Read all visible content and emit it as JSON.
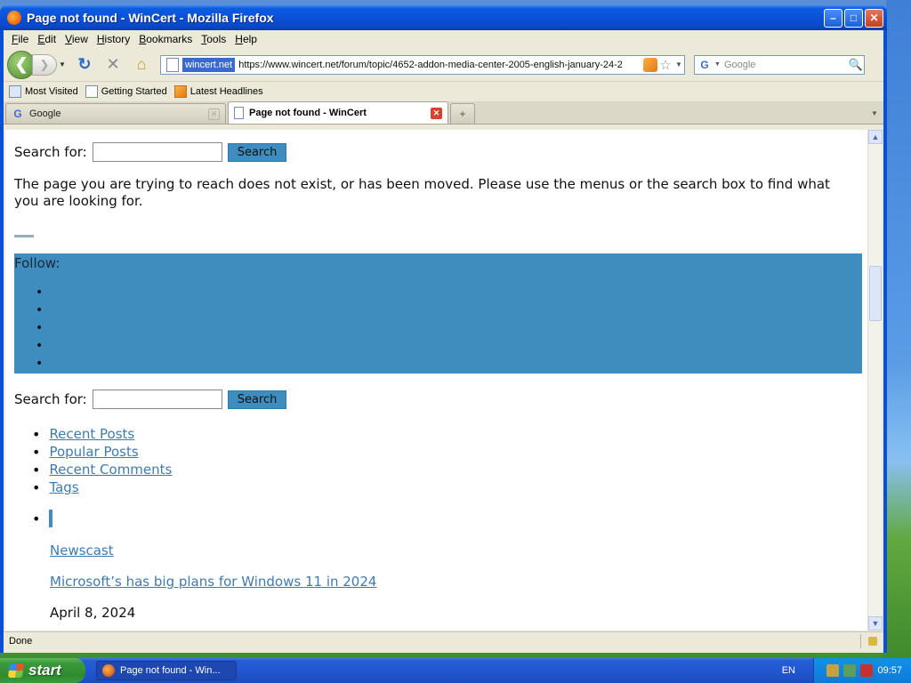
{
  "window": {
    "title": "Page not found - WinCert - Mozilla Firefox"
  },
  "menu": [
    "File",
    "Edit",
    "View",
    "History",
    "Bookmarks",
    "Tools",
    "Help"
  ],
  "navbar": {
    "site_identity": "wincert.net",
    "url": "https://www.wincert.net/forum/topic/4652-addon-media-center-2005-english-january-24-2",
    "search_placeholder": "Google"
  },
  "bookmarks": [
    {
      "label": "Most Visited",
      "icon": "most-visited-icon"
    },
    {
      "label": "Getting Started",
      "icon": "page-icon"
    },
    {
      "label": "Latest Headlines",
      "icon": "rss-feed-icon"
    }
  ],
  "tabs": [
    {
      "label": "Google",
      "active": false
    },
    {
      "label": "Page not found - WinCert",
      "active": true
    }
  ],
  "page": {
    "search_label": "Search for:",
    "search_button": "Search",
    "not_found_message": "The page you are trying to reach does not exist, or has been moved. Please use the menus or the search box to find what you are looking for.",
    "follow_label": "Follow:",
    "follow_bullets": [
      "•",
      "•",
      "•",
      "•",
      "•"
    ],
    "links": [
      "Recent Posts",
      "Popular Posts",
      "Recent Comments",
      "Tags"
    ],
    "post_category": "Newscast",
    "post_title": "Microsoft’s has big plans for Windows 11 in 2024",
    "post_date": "April 8, 2024"
  },
  "status": {
    "text": "Done"
  },
  "taskbar": {
    "start_label": "start",
    "task_label": "Page not found - Win...",
    "language": "EN",
    "clock": "09:57"
  },
  "colors": {
    "accent": "#3e8dbe",
    "link": "#3e7bb0",
    "titlebar": "#0a50d8"
  }
}
